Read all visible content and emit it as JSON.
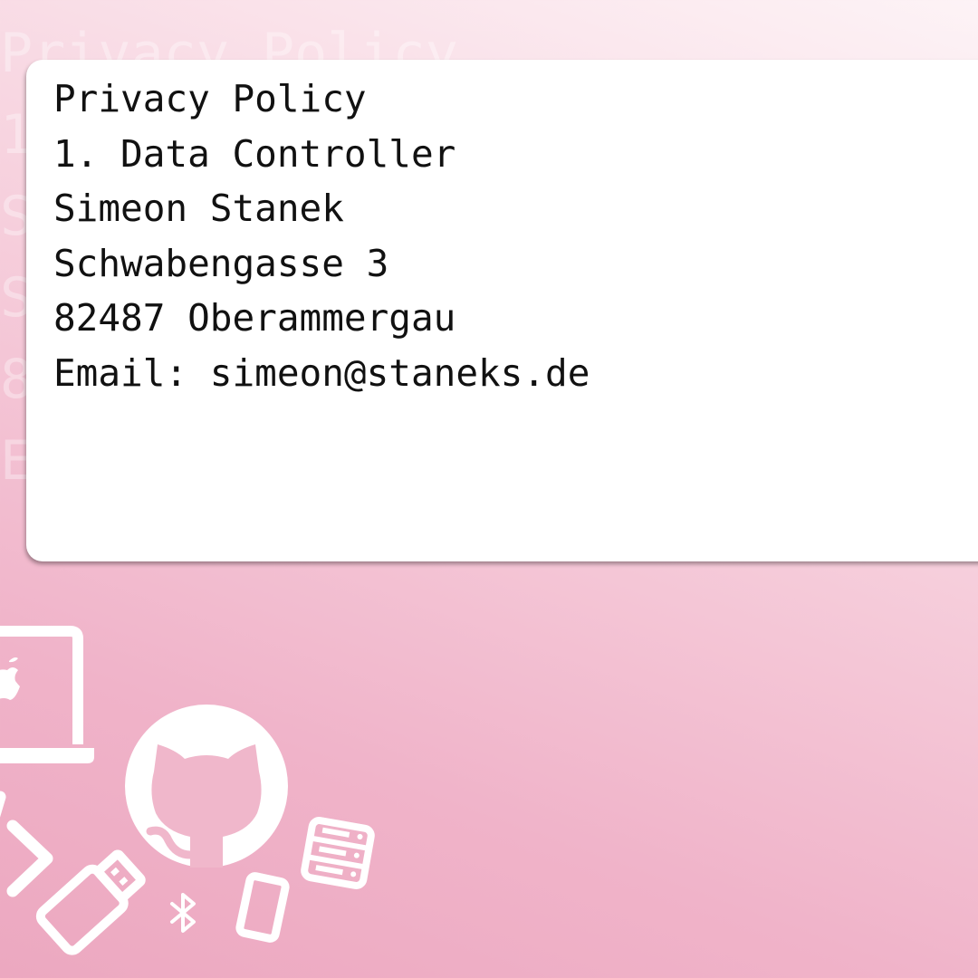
{
  "document": {
    "lines": [
      "Privacy Policy",
      "1. Data Controller",
      "Simeon Stanek",
      "Schwabengasse 3",
      "82487 Oberammergau",
      "Email: simeon@staneks.de"
    ]
  },
  "background_text": {
    "lines": [
      "Privacy Policy",
      "1",
      "S",
      "S",
      "8",
      "E"
    ]
  },
  "decorations": {
    "icons": [
      "laptop-icon",
      "apple-logo-icon",
      "github-octocat-icon",
      "code-chevron-icon",
      "usb-stick-icon",
      "bluetooth-icon",
      "smartphone-icon",
      "server-icon"
    ],
    "icon_color": "#ffffff"
  },
  "colors": {
    "card_background": "#ffffff",
    "text": "#111111",
    "background_light": "#fdf3f6",
    "background_pink": "#eca8c0"
  }
}
